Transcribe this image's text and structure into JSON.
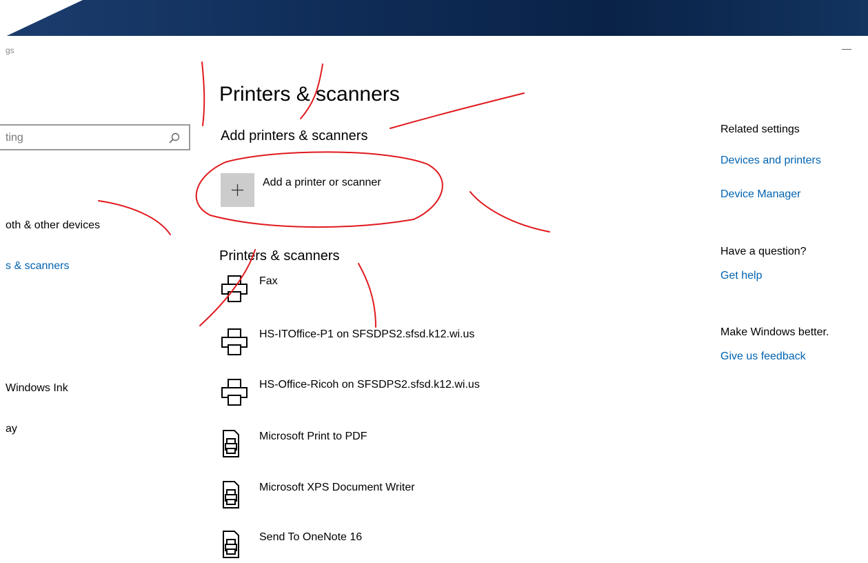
{
  "window": {
    "title_fragment": "gs",
    "minimize_glyph": "—"
  },
  "search": {
    "value_fragment": "ting"
  },
  "sidebar": {
    "items": [
      {
        "label": "oth & other devices",
        "active": false
      },
      {
        "label": "s & scanners",
        "active": true
      },
      {
        "label": "Windows Ink",
        "active": false
      },
      {
        "label": "ay",
        "active": false
      }
    ]
  },
  "main": {
    "title": "Printers & scanners",
    "add_section_heading": "Add printers & scanners",
    "add_button_label": "Add a printer or scanner",
    "list_heading": "Printers & scanners",
    "printers": [
      {
        "name": "Fax",
        "icon": "printer-icon"
      },
      {
        "name": "HS-ITOffice-P1 on SFSDPS2.sfsd.k12.wi.us",
        "icon": "printer-icon"
      },
      {
        "name": "HS-Office-Ricoh on SFSDPS2.sfsd.k12.wi.us",
        "icon": "printer-icon"
      },
      {
        "name": "Microsoft Print to PDF",
        "icon": "document-printer-icon"
      },
      {
        "name": "Microsoft XPS Document Writer",
        "icon": "document-printer-icon"
      },
      {
        "name": "Send To OneNote 16",
        "icon": "document-printer-icon"
      }
    ]
  },
  "related": {
    "heading": "Related settings",
    "devices_and_printers": "Devices and printers",
    "device_manager": "Device Manager",
    "question_heading": "Have a question?",
    "get_help": "Get help",
    "better_heading": "Make Windows better.",
    "feedback": "Give us feedback"
  },
  "colors": {
    "link": "#0063b1",
    "banner": "#0f2c57",
    "annotation": "#e0191d"
  }
}
